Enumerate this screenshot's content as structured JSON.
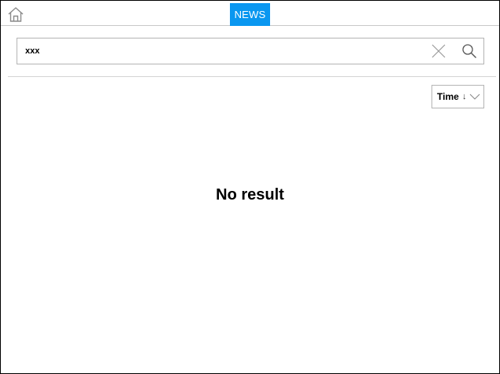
{
  "header": {
    "home_icon": "home-icon",
    "active_tab": "NEWS",
    "tab_color": "#0a97f0"
  },
  "search": {
    "value": "xxx",
    "clear_icon": "close-icon",
    "search_icon": "search-icon"
  },
  "sort": {
    "label": "Time",
    "direction_glyph": "↓",
    "dropdown_icon": "chevron-down-icon"
  },
  "results": {
    "empty_message": "No result"
  }
}
